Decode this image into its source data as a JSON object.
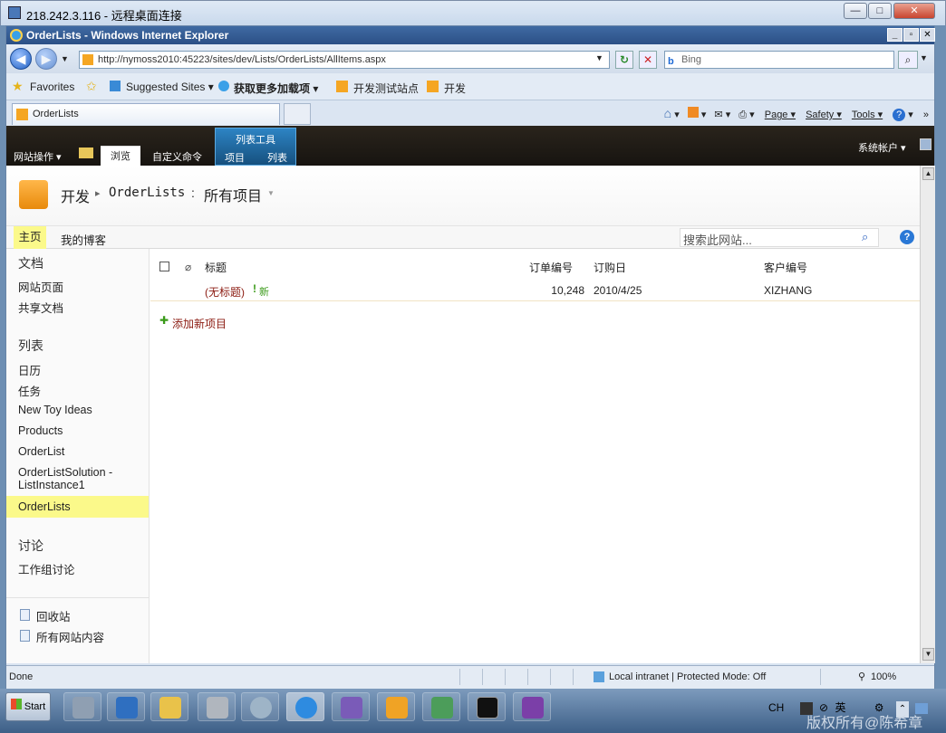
{
  "rdp": {
    "title": "218.242.3.116 - 远程桌面连接",
    "min": "—",
    "max": "□",
    "close": "✕"
  },
  "ie": {
    "window_title": "OrderLists - Windows Internet Explorer",
    "address": "http://nymoss2010:45223/sites/dev/Lists/OrderLists/AllItems.aspx",
    "search_placeholder": "Bing",
    "favorites_label": "Favorites",
    "suggested_sites": "Suggested Sites ▾",
    "get_addons": "获取更多加载项 ▾",
    "fav_dev_test": "开发测试站点",
    "fav_dev": "开发",
    "tab_title": "OrderLists",
    "cmd_page": "Page ▾",
    "cmd_safety": "Safety ▾",
    "cmd_tools": "Tools ▾",
    "status_done": "Done",
    "status_zone": "Local intranet | Protected Mode: Off",
    "status_zoom": "100%"
  },
  "ribbon": {
    "site_actions": "网站操作 ▾",
    "browse": "浏览",
    "custom_commands": "自定义命令",
    "list_tools": "列表工具",
    "items": "项目",
    "list": "列表",
    "user": "系统帐户 ▾"
  },
  "breadcrumb": {
    "site": "开发",
    "sep": "▸",
    "list": "OrderLists",
    "colon": ":",
    "view": "所有项目"
  },
  "topnav": {
    "home": "主页",
    "blog": "我的博客",
    "search_placeholder": "搜索此网站..."
  },
  "quicklaunch": {
    "docs_heading": "文档",
    "docs": [
      "网站页面",
      "共享文档"
    ],
    "lists_heading": "列表",
    "lists": [
      "日历",
      "任务",
      "New Toy Ideas",
      "Products",
      "OrderList",
      "OrderListSolution -",
      "ListInstance1",
      "OrderLists"
    ],
    "disc_heading": "讨论",
    "discussions": [
      "工作组讨论"
    ],
    "recycle": "回收站",
    "all_content": "所有网站内容"
  },
  "table": {
    "headers": [
      "标题",
      "订单编号",
      "订购日",
      "客户编号"
    ],
    "rows": [
      {
        "title": "(无标题)",
        "new_tag": "新",
        "order_no": "10,248",
        "date": "2010/4/25",
        "customer": "XIZHANG"
      }
    ],
    "add_new": "添加新项目"
  },
  "taskbar": {
    "start": "Start",
    "lang": "CH",
    "ime": "英",
    "watermark": "版权所有@陈希章"
  },
  "colors": {
    "ribbon_bg": "#1e1a14",
    "accent_blue": "#2d84c4",
    "sp_orange": "#f5a623",
    "link_red": "#8b1a10",
    "new_green": "#3a9a19"
  }
}
